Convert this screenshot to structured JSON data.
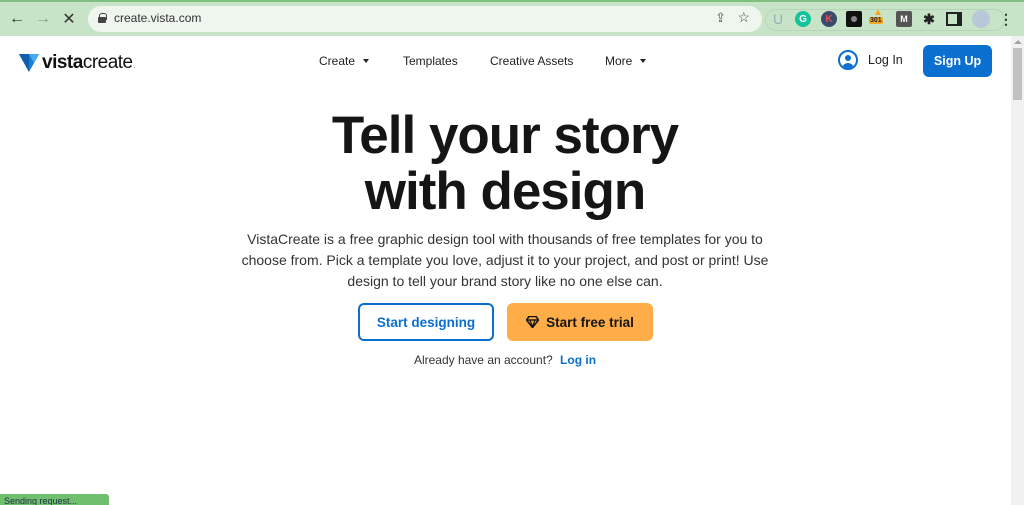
{
  "browser": {
    "url": "create.vista.com",
    "back_icon": "arrow-left",
    "forward_icon": "arrow-right",
    "stop_icon": "close",
    "extensions": [
      {
        "name": "u-extension",
        "label": "U"
      },
      {
        "name": "grammarly",
        "label": "G"
      },
      {
        "name": "k-extension",
        "label": "K"
      },
      {
        "name": "camera-extension",
        "label": ""
      },
      {
        "name": "badge-extension",
        "label": "301"
      },
      {
        "name": "m-extension",
        "label": "M"
      },
      {
        "name": "extensions-puzzle",
        "label": "✱"
      },
      {
        "name": "side-panel",
        "label": ""
      },
      {
        "name": "profile-avatar",
        "label": ""
      },
      {
        "name": "menu",
        "label": "⋮"
      }
    ]
  },
  "header": {
    "logo_bold": "vista",
    "logo_light": "create",
    "logo_dot": ".",
    "nav": [
      {
        "label": "Create",
        "has_dropdown": true
      },
      {
        "label": "Templates",
        "has_dropdown": false
      },
      {
        "label": "Creative Assets",
        "has_dropdown": false
      },
      {
        "label": "More",
        "has_dropdown": true
      }
    ],
    "login_label": "Log In",
    "signup_label": "Sign Up"
  },
  "hero": {
    "title_line1": "Tell your story",
    "title_line2": "with design",
    "description_line1": "VistaCreate is a free graphic design tool with thousands of free templates for you to",
    "description_line2": "choose from. Pick a template you love, adjust it to your project, and post or print! Use",
    "description_line3": "design to tell your brand story like no one else can.",
    "primary_button": "Start designing",
    "trial_button": "Start free trial",
    "account_prompt": "Already have an account?",
    "account_link": "Log in"
  },
  "status": {
    "text": "Sending request..."
  },
  "colors": {
    "brand_blue": "#0b6fcf",
    "trial_orange": "#ffad49",
    "chrome_green": "#c8e4c8"
  }
}
